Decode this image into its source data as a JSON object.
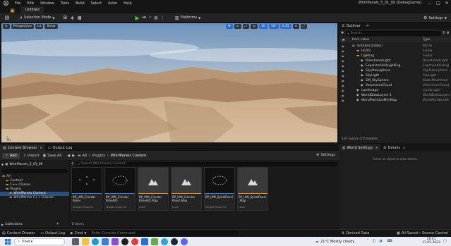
{
  "menu": {
    "items": [
      "File",
      "Edit",
      "Window",
      "Tools",
      "Build",
      "Select",
      "Actor",
      "Help"
    ],
    "project": "WhirlPanels_5_01_00 [DebugGame]"
  },
  "level_tab": {
    "label": "Untitled"
  },
  "toolbar": {
    "selection_mode": "Selection Mode",
    "platforms": "Platforms",
    "settings": "Settings"
  },
  "viewport": {
    "perspective": "Perspective",
    "lit": "Lit",
    "show": "Show",
    "grid_snap": "10",
    "rot_snap": "10°",
    "scale_snap": "0.25",
    "camera_speed": "4"
  },
  "outliner": {
    "tab": "Outliner",
    "search_placeholder": "Search...",
    "col_label": "Item Label",
    "col_type": "Type",
    "rows": [
      {
        "label": "Untitled (Editor)",
        "type": "World"
      },
      {
        "label": "HLOD",
        "type": "Folder"
      },
      {
        "label": "Lighting",
        "type": "Folder"
      },
      {
        "label": "DirectionalLight",
        "type": "DirectionalLight"
      },
      {
        "label": "ExponentialHeightFog",
        "type": "ExponentialHeig"
      },
      {
        "label": "SkyAtmosphere",
        "type": "SkyAtmosphere"
      },
      {
        "label": "SkyLight",
        "type": "SkyLight"
      },
      {
        "label": "SM_SkySphere",
        "type": "StaticMeshActor"
      },
      {
        "label": "VolumetricCloud",
        "type": "VolumetricCloud"
      },
      {
        "label": "Landscape",
        "type": "Landscape"
      },
      {
        "label": "WorldDataLayers-1",
        "type": "WorldDataLayers"
      },
      {
        "label": "WorldPartitionMiniMap",
        "type": "WorldPartitionMi"
      }
    ],
    "footer": "137 actors (73 loaded)"
  },
  "content_browser": {
    "tab": "Content Browser",
    "output_tab": "Output Log",
    "add": "Add",
    "import": "Import",
    "save_all": "Save All",
    "breadcrumb": [
      "All",
      "Plugins",
      "WhirlPanels Content"
    ],
    "settings": "Settings",
    "search_placeholder": "Search WhirlPanels Content",
    "root_label": "WhirlPanels_5_01_00",
    "tree": [
      {
        "label": "All",
        "indent": 0
      },
      {
        "label": "Content",
        "indent": 1
      },
      {
        "label": "C++ Classes",
        "indent": 1
      },
      {
        "label": "Plugins",
        "indent": 1
      },
      {
        "label": "WhirlPanels Content",
        "indent": 2,
        "selected": true
      },
      {
        "label": "WhirlPanels C++ Classes",
        "indent": 2
      }
    ],
    "collections": "Collections",
    "assets": [
      {
        "name": "BP_UMI_Circular Panel",
        "type": "Widget Blueprint",
        "kind": "dots"
      },
      {
        "name": "BP_UMI_Circular PanelSD",
        "type": "Widget Blueprint",
        "kind": "ring"
      },
      {
        "name": "BP_UMI_Circular PanelSD_Map",
        "type": "Level",
        "kind": "level"
      },
      {
        "name": "BP_UMI_Circular Panel_Map",
        "type": "Level",
        "kind": "level"
      },
      {
        "name": "BP_UMI_SpiralPanel",
        "type": "Widget Blueprint",
        "kind": "ring"
      },
      {
        "name": "BP_UMI_SpiralPanel _Map",
        "type": "Level",
        "kind": "level"
      }
    ],
    "item_count": "6 items"
  },
  "world_settings": {
    "tab": "World Settings",
    "details_tab": "Details",
    "empty_text": "Select an object to view details."
  },
  "status": {
    "content_drawer": "Content Drawer",
    "output_log": "Output Log",
    "cmd": "Cmd",
    "cmd_placeholder": "Enter Console Command",
    "derived_data": "Derived Data",
    "all_saved": "All Saved",
    "source_control": "Source Control"
  },
  "taskbar": {
    "search": "Поиск",
    "weather": "21°C Mostly cloudy",
    "time": "18:41",
    "date": "17.05.2023"
  }
}
